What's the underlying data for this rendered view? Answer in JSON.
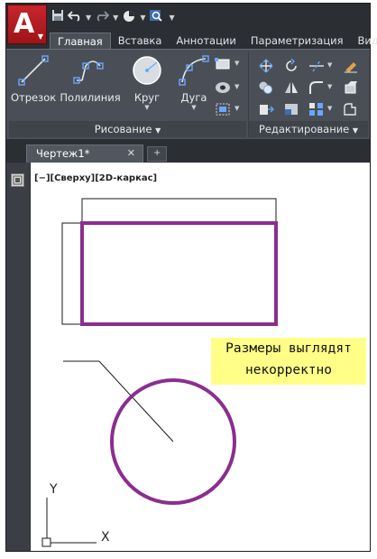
{
  "app": {
    "logo_letter": "A",
    "logo_color": "#c8262c"
  },
  "quick_access": {
    "icons": [
      "save-icon",
      "undo-icon",
      "redo-icon",
      "workspace-icon",
      "search-icon"
    ]
  },
  "ribbon": {
    "tabs": [
      {
        "label": "Главная",
        "active": true
      },
      {
        "label": "Вставка",
        "active": false
      },
      {
        "label": "Аннотации",
        "active": false
      },
      {
        "label": "Параметризация",
        "active": false
      },
      {
        "label": "Вид",
        "active": false
      }
    ],
    "draw_panel": {
      "title": "Рисование",
      "tools": [
        {
          "label": "Отрезок"
        },
        {
          "label": "Полилиния"
        },
        {
          "label": "Круг"
        },
        {
          "label": "Дуга"
        }
      ]
    },
    "modify_panel": {
      "title": "Редактирование"
    }
  },
  "document": {
    "tab_name": "Чертеж1*",
    "close_glyph": "✕"
  },
  "viewport": {
    "label": "[−][Сверху][2D-каркас]"
  },
  "drawing": {
    "highlight_color": "#8a2e8f",
    "note_lines": [
      "Размеры выглядят",
      "некорректно"
    ],
    "note_bg": "#ffff88"
  },
  "ucs": {
    "x_label": "X",
    "y_label": "Y"
  }
}
